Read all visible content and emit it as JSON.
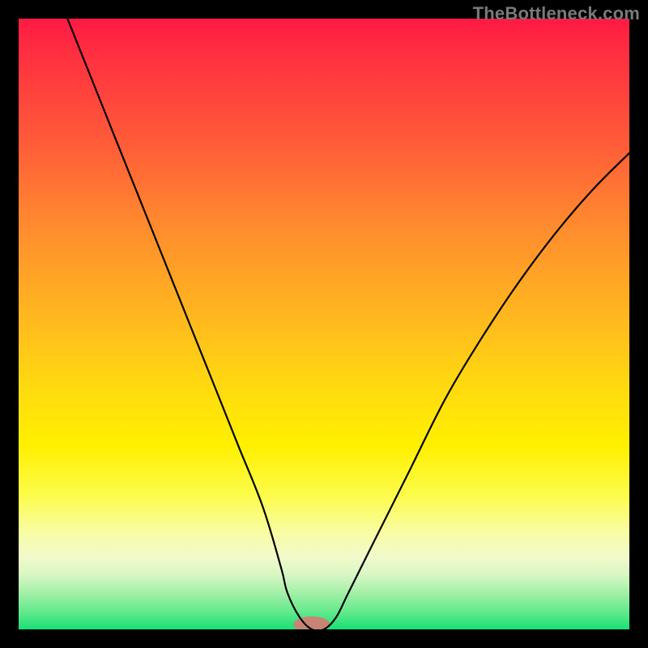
{
  "watermark": "TheBottleneck.com",
  "colors": {
    "background": "#000000",
    "gradient_top": "#ff1a44",
    "gradient_bottom": "#18e074",
    "curve": "#000000",
    "basin": "#d87a74"
  },
  "chart_data": {
    "type": "line",
    "title": "",
    "xlabel": "",
    "ylabel": "",
    "xlim": [
      0,
      100
    ],
    "ylim": [
      0,
      100
    ],
    "grid": false,
    "legend": false,
    "series": [
      {
        "name": "bottleneck-curve",
        "x": [
          8,
          12,
          16,
          20,
          24,
          28,
          32,
          36,
          40,
          43,
          44,
          46,
          48,
          50,
          52,
          54,
          58,
          64,
          70,
          76,
          82,
          88,
          94,
          100
        ],
        "y": [
          100,
          90,
          80,
          70,
          60,
          50,
          40,
          30,
          20,
          10,
          6,
          2,
          0,
          0,
          2,
          6,
          14,
          26,
          38,
          48,
          57,
          65,
          72,
          78
        ]
      }
    ],
    "annotations": [
      {
        "name": "min-basin",
        "x_center": 48,
        "y": 0,
        "width": 6
      }
    ]
  }
}
